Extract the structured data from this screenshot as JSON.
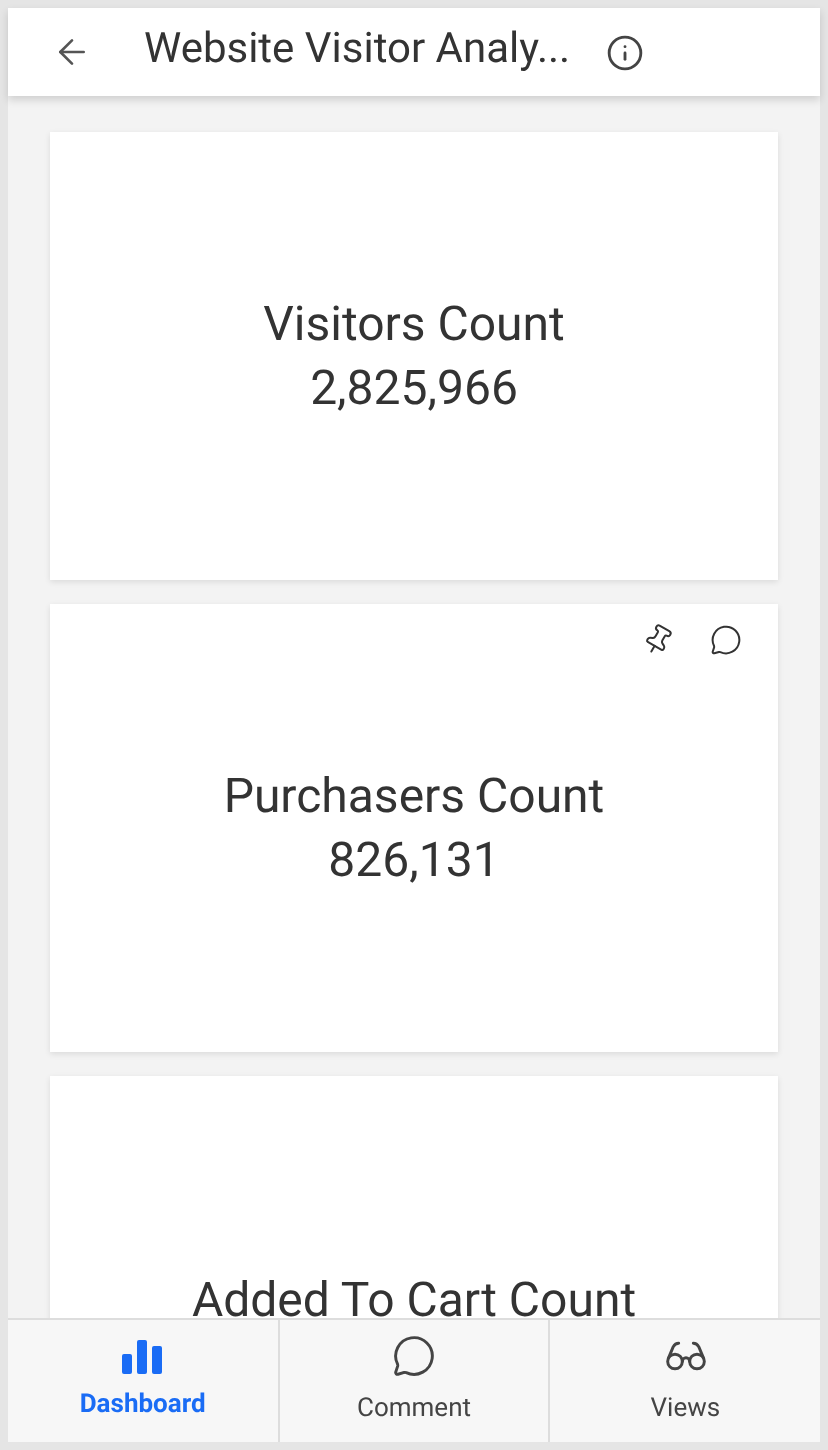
{
  "header": {
    "title": "Website Visitor Analy..."
  },
  "cards": [
    {
      "title": "Visitors Count",
      "value": "2,825,966",
      "actions": false
    },
    {
      "title": "Purchasers Count",
      "value": "826,131",
      "actions": true
    },
    {
      "title": "Added To Cart Count",
      "actions": false
    }
  ],
  "nav": [
    {
      "label": "Dashboard",
      "kind": "chart",
      "selected": true
    },
    {
      "label": "Comment",
      "kind": "comment",
      "selected": false
    },
    {
      "label": "Views",
      "kind": "glasses",
      "selected": false
    }
  ]
}
